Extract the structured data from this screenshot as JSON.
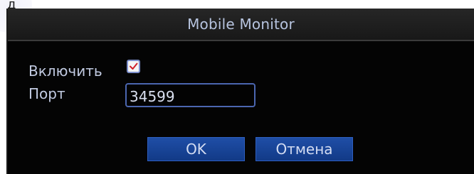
{
  "background_text": "д",
  "dialog": {
    "title": "Mobile Monitor",
    "enable_label": "Включить",
    "enable_checked": true,
    "port_label": "Порт",
    "port_value": "34599",
    "ok_label": "OK",
    "cancel_label": "Отмена"
  },
  "colors": {
    "dialog_background": "#040404",
    "title_text": "#b7c4df",
    "label_text": "#c2cbe2",
    "button_fill": "#1a4596",
    "input_border": "#4b66b0",
    "check_mark": "#d0202a"
  },
  "icons": {
    "checkbox": "check-mark-icon"
  }
}
